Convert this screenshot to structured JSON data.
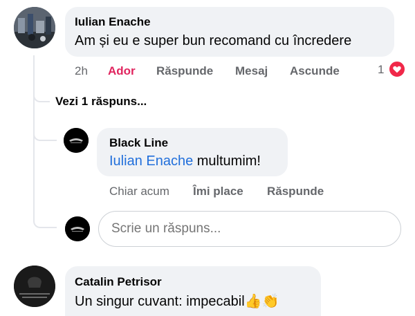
{
  "comment1": {
    "author": "Iulian Enache",
    "text": "Am și eu e super bun recomand cu încredere",
    "time": "2h",
    "like_label": "Ador",
    "reply_label": "Răspunde",
    "message_label": "Mesaj",
    "hide_label": "Ascunde",
    "reaction_count": "1",
    "view_replies": "Vezi 1 răspuns..."
  },
  "reply": {
    "author": "Black Line",
    "mention": "Iulian Enache",
    "text": " multumim!",
    "time": "Chiar acum",
    "like_label": "Îmi place",
    "reply_label": "Răspunde"
  },
  "reply_input": {
    "placeholder": "Scrie un răspuns..."
  },
  "comment2": {
    "author": "Catalin Petrisor",
    "text": "Un singur cuvant: impecabil",
    "emojis": "👍👏"
  },
  "colors": {
    "like_active": "#e0245e",
    "mention": "#216fdb",
    "bubble": "#f0f2f5",
    "heart": "#f02849"
  }
}
